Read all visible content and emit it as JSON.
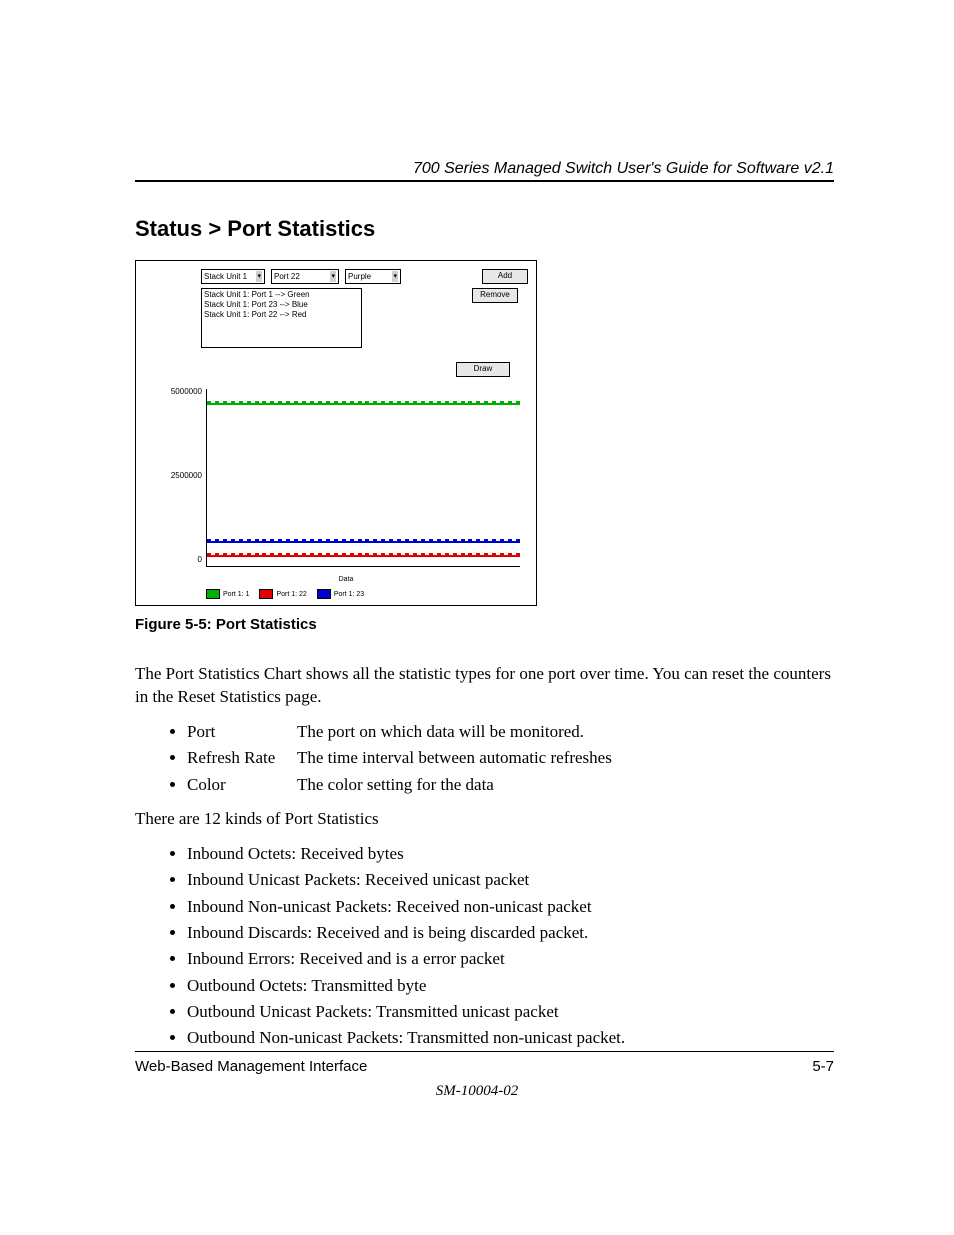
{
  "header": {
    "running": "700 Series Managed Switch User's Guide for Software v2.1"
  },
  "section": {
    "title": "Status > Port Statistics"
  },
  "figure": {
    "controls": {
      "unit_select": "Stack Unit 1",
      "port_select": "Port 22",
      "color_select": "Purple",
      "add_button": "Add",
      "remove_button": "Remove",
      "draw_button": "Draw",
      "list_items": [
        "Stack Unit 1: Port 1 --> Green",
        "Stack Unit 1: Port 23 --> Blue",
        "Stack Unit 1: Port 22 --> Red"
      ]
    },
    "chart": {
      "y_ticks": [
        "5000000",
        "2500000",
        "0"
      ],
      "x_label": "Data",
      "legend": [
        {
          "label": "Port 1: 1",
          "color": "#00b000"
        },
        {
          "label": "Port 1: 22",
          "color": "#e00000"
        },
        {
          "label": "Port 1: 23",
          "color": "#0000d0"
        }
      ]
    },
    "caption": "Figure 5-5:  Port Statistics"
  },
  "chart_data": {
    "type": "line",
    "title": "",
    "xlabel": "Data",
    "ylabel": "",
    "ylim": [
      0,
      5000000
    ],
    "x": [
      1,
      2,
      3,
      4,
      5,
      6,
      7,
      8,
      9,
      10,
      11,
      12,
      13,
      14,
      15,
      16,
      17,
      18,
      19,
      20,
      21,
      22,
      23,
      24,
      25,
      26,
      27,
      28,
      29,
      30,
      31,
      32,
      33,
      34,
      35,
      36,
      37,
      38,
      39,
      40
    ],
    "series": [
      {
        "name": "Port 1: 1",
        "color": "#00b000",
        "values": [
          4450000,
          4500000,
          4520000,
          4540000,
          4550000,
          4560000,
          4570000,
          4580000,
          4585000,
          4590000,
          4595000,
          4600000,
          4600000,
          4600000,
          4605000,
          4610000,
          4610000,
          4615000,
          4615000,
          4620000,
          4620000,
          4620000,
          4625000,
          4625000,
          4625000,
          4630000,
          4630000,
          4630000,
          4635000,
          4635000,
          4640000,
          4640000,
          4640000,
          4645000,
          4645000,
          4650000,
          4650000,
          4660000,
          4670000,
          4680000
        ]
      },
      {
        "name": "Port 1: 22",
        "color": "#e00000",
        "values": [
          200000,
          200000,
          200000,
          200000,
          200000,
          200000,
          200000,
          200000,
          200000,
          200000,
          200000,
          200000,
          200000,
          200000,
          200000,
          200000,
          200000,
          200000,
          200000,
          200000,
          200000,
          200000,
          200000,
          200000,
          200000,
          200000,
          200000,
          200000,
          200000,
          200000,
          200000,
          200000,
          200000,
          200000,
          200000,
          200000,
          200000,
          200000,
          220000,
          240000
        ]
      },
      {
        "name": "Port 1: 23",
        "color": "#0000d0",
        "values": [
          550000,
          550000,
          550000,
          550000,
          550000,
          550000,
          550000,
          550000,
          555000,
          555000,
          555000,
          555000,
          555000,
          555000,
          560000,
          560000,
          560000,
          560000,
          560000,
          560000,
          560000,
          560000,
          560000,
          560000,
          560000,
          560000,
          560000,
          560000,
          560000,
          560000,
          560000,
          560000,
          560000,
          560000,
          560000,
          560000,
          560000,
          560000,
          570000,
          580000
        ]
      }
    ]
  },
  "body": {
    "intro": "The Port Statistics Chart shows all the statistic types for one port over time.  You can reset the counters in the Reset Statistics page.",
    "defs": [
      {
        "term": "Port",
        "desc": "The port on which data will be monitored."
      },
      {
        "term": "Refresh Rate",
        "desc": "The time interval between automatic refreshes"
      },
      {
        "term": "Color",
        "desc": "The color setting for the data"
      }
    ],
    "stats_intro": "There are 12 kinds of Port Statistics",
    "stats": [
      "Inbound Octets: Received bytes",
      "Inbound Unicast Packets: Received unicast packet",
      "Inbound Non-unicast Packets: Received non-unicast packet",
      "Inbound Discards: Received and is being discarded packet.",
      "Inbound Errors: Received and is a error packet",
      "Outbound Octets: Transmitted byte",
      "Outbound Unicast Packets: Transmitted unicast packet",
      "Outbound Non-unicast Packets: Transmitted non-unicast packet."
    ]
  },
  "footer": {
    "left": "Web-Based Management Interface",
    "right": "5-7",
    "center": "SM-10004-02"
  }
}
